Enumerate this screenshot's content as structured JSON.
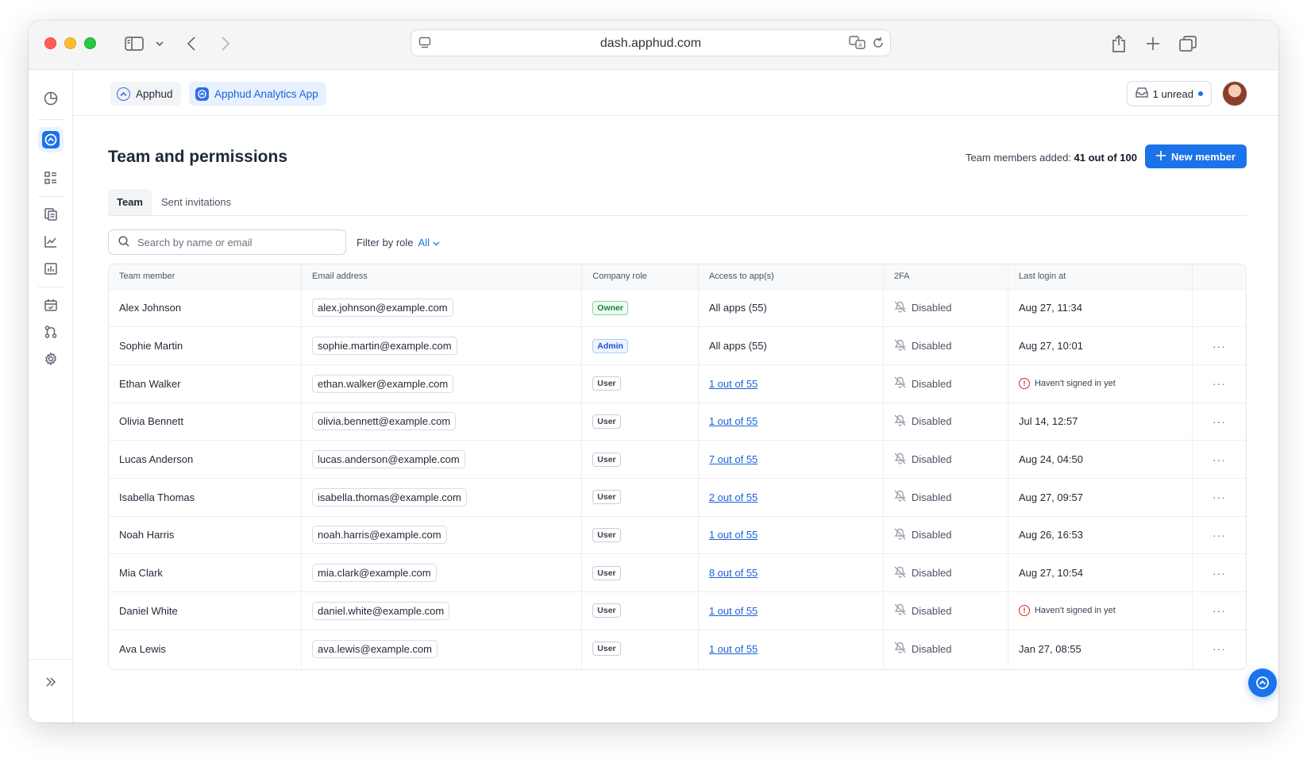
{
  "browser": {
    "url": "dash.apphud.com"
  },
  "header": {
    "chips": [
      {
        "label": "Apphud"
      },
      {
        "label": "Apphud Analytics App"
      }
    ],
    "unread_label": "1 unread"
  },
  "page": {
    "title": "Team and permissions",
    "members_added_label": "Team members added:",
    "members_added_value": "41 out of 100",
    "new_member_label": "New member"
  },
  "tabs": [
    {
      "label": "Team",
      "active": true
    },
    {
      "label": "Sent invitations",
      "active": false
    }
  ],
  "search": {
    "placeholder": "Search by name or email"
  },
  "filter": {
    "label": "Filter by role",
    "value": "All"
  },
  "table": {
    "columns": [
      "Team member",
      "Email address",
      "Company role",
      "Access to app(s)",
      "2FA",
      "Last login at"
    ],
    "rows": [
      {
        "name": "Alex Johnson",
        "email": "alex.johnson@example.com",
        "role": "Owner",
        "access": "All apps (55)",
        "access_link": false,
        "twofa": "Disabled",
        "last_login": "Aug 27, 11:34",
        "never": false,
        "more": false
      },
      {
        "name": "Sophie Martin",
        "email": "sophie.martin@example.com",
        "role": "Admin",
        "access": "All apps (55)",
        "access_link": false,
        "twofa": "Disabled",
        "last_login": "Aug 27, 10:01",
        "never": false,
        "more": true
      },
      {
        "name": "Ethan Walker",
        "email": "ethan.walker@example.com",
        "role": "User",
        "access": "1 out of 55",
        "access_link": true,
        "twofa": "Disabled",
        "last_login": "Haven't signed in yet",
        "never": true,
        "more": true
      },
      {
        "name": "Olivia Bennett",
        "email": "olivia.bennett@example.com",
        "role": "User",
        "access": "1 out of 55",
        "access_link": true,
        "twofa": "Disabled",
        "last_login": "Jul 14, 12:57",
        "never": false,
        "more": true
      },
      {
        "name": "Lucas Anderson",
        "email": "lucas.anderson@example.com",
        "role": "User",
        "access": "7 out of 55",
        "access_link": true,
        "twofa": "Disabled",
        "last_login": "Aug 24, 04:50",
        "never": false,
        "more": true
      },
      {
        "name": "Isabella Thomas",
        "email": "isabella.thomas@example.com",
        "role": "User",
        "access": "2 out of 55",
        "access_link": true,
        "twofa": "Disabled",
        "last_login": "Aug 27, 09:57",
        "never": false,
        "more": true
      },
      {
        "name": "Noah Harris",
        "email": "noah.harris@example.com",
        "role": "User",
        "access": "1 out of 55",
        "access_link": true,
        "twofa": "Disabled",
        "last_login": "Aug 26, 16:53",
        "never": false,
        "more": true
      },
      {
        "name": "Mia Clark",
        "email": "mia.clark@example.com",
        "role": "User",
        "access": "8 out of 55",
        "access_link": true,
        "twofa": "Disabled",
        "last_login": "Aug 27, 10:54",
        "never": false,
        "more": true
      },
      {
        "name": "Daniel White",
        "email": "daniel.white@example.com",
        "role": "User",
        "access": "1 out of 55",
        "access_link": true,
        "twofa": "Disabled",
        "last_login": "Haven't signed in yet",
        "never": true,
        "more": true
      },
      {
        "name": "Ava Lewis",
        "email": "ava.lewis@example.com",
        "role": "User",
        "access": "1 out of 55",
        "access_link": true,
        "twofa": "Disabled",
        "last_login": "Jan 27, 08:55",
        "never": false,
        "more": true
      }
    ]
  },
  "icons": {
    "rail": [
      "pie-chart-icon",
      "apphud-logo-icon",
      "dashboard-grid-icon",
      "reports-icon",
      "line-chart-icon",
      "bar-chart-icon",
      "calendar-icon",
      "flows-icon",
      "settings-icon",
      "expand-icon"
    ]
  },
  "colors": {
    "accent": "#1a73e8",
    "owner": "#15803d",
    "admin": "#1d4ed8",
    "danger": "#dc2626"
  }
}
